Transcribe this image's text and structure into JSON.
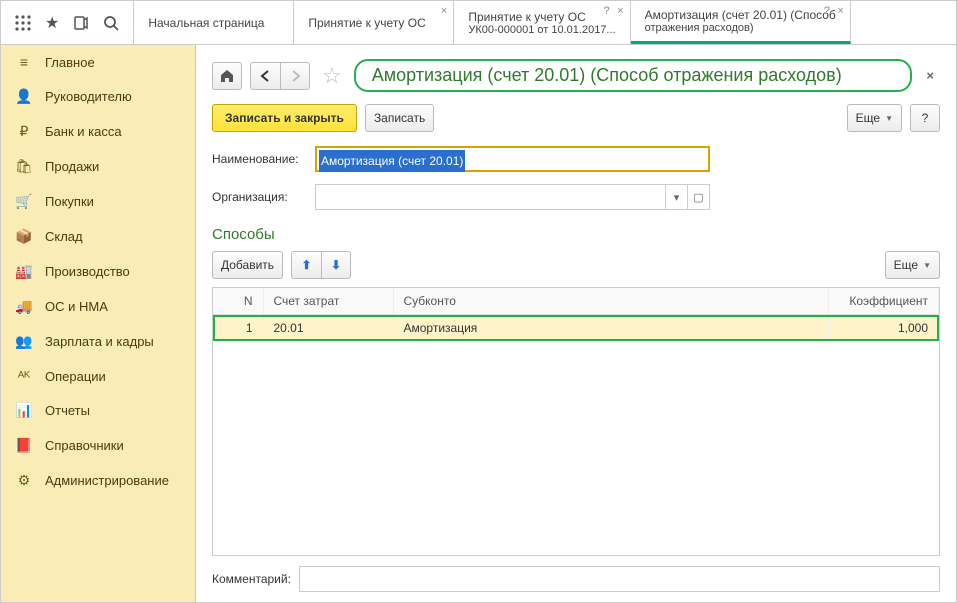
{
  "topbar": {
    "tabs": [
      {
        "label": "Начальная страница"
      },
      {
        "label": "Принятие к учету ОС",
        "closable": true
      },
      {
        "label": "Принятие к учету ОС",
        "line2": "УК00-000001 от 10.01.2017...",
        "closable": true,
        "help": true
      },
      {
        "label": "Амортизация (счет 20.01) (Способ",
        "line2": "отражения расходов)",
        "closable": true,
        "help": true,
        "active": true
      }
    ]
  },
  "sidebar": {
    "items": [
      {
        "icon": "≡",
        "label": "Главное"
      },
      {
        "icon": "👤",
        "label": "Руководителю"
      },
      {
        "icon": "₽",
        "label": "Банк и касса"
      },
      {
        "icon": "🛍",
        "label": "Продажи"
      },
      {
        "icon": "🛒",
        "label": "Покупки"
      },
      {
        "icon": "📦",
        "label": "Склад"
      },
      {
        "icon": "🏭",
        "label": "Производство"
      },
      {
        "icon": "🚚",
        "label": "ОС и НМА"
      },
      {
        "icon": "👥",
        "label": "Зарплата и кадры"
      },
      {
        "icon": "ᴬᴷ",
        "label": "Операции"
      },
      {
        "icon": "📊",
        "label": "Отчеты"
      },
      {
        "icon": "📕",
        "label": "Справочники"
      },
      {
        "icon": "⚙",
        "label": "Администрирование"
      }
    ]
  },
  "page": {
    "title": "Амортизация (счет 20.01) (Способ отражения расходов)",
    "toolbar": {
      "save_close": "Записать и закрыть",
      "save": "Записать",
      "more": "Еще"
    },
    "fields": {
      "name_label": "Наименование:",
      "name_value": "Амортизация (счет 20.01)",
      "org_label": "Организация:",
      "org_value": ""
    },
    "section": "Способы",
    "tbl_toolbar": {
      "add": "Добавить",
      "more": "Еще"
    },
    "table": {
      "headers": {
        "n": "N",
        "account": "Счет затрат",
        "subconto": "Субконто",
        "coef": "Коэффициент"
      },
      "rows": [
        {
          "n": "1",
          "account": "20.01",
          "subconto": "Амортизация",
          "coef": "1,000"
        }
      ]
    },
    "comment_label": "Комментарий:",
    "comment_value": ""
  }
}
